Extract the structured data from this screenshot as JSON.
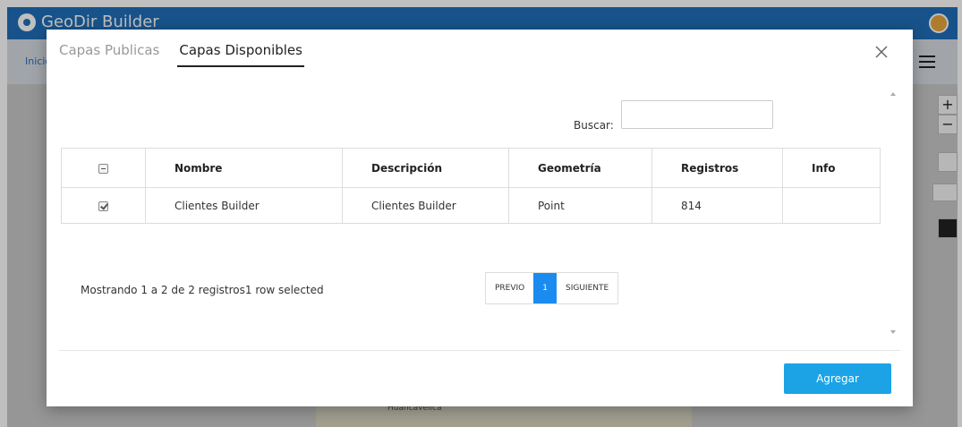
{
  "app": {
    "title": "GeoDir Builder",
    "breadcrumb": "Inicio",
    "map_label": "Huancavelica"
  },
  "map_controls": {
    "zoom_in": "+",
    "zoom_out": "−"
  },
  "modal": {
    "tabs": [
      {
        "label": "Capas Publicas",
        "active": false
      },
      {
        "label": "Capas Disponibles",
        "active": true
      }
    ],
    "close_icon": "close-icon",
    "search": {
      "label": "Buscar:",
      "value": ""
    },
    "table": {
      "columns": [
        "",
        "Nombre",
        "Descripción",
        "Geometría",
        "Registros",
        "Info"
      ],
      "rows": [
        {
          "selected": true,
          "nombre": "Clientes Builder",
          "descripcion": "Clientes Builder",
          "geometria": "Point",
          "registros": "814",
          "info": ""
        }
      ]
    },
    "info_text": "Mostrando 1 a 2 de 2 registros1 row selected",
    "pagination": {
      "prev": "PREVIO",
      "current": "1",
      "next": "SIGUIENTE"
    },
    "add_button": "Agregar"
  },
  "colors": {
    "header": "#1f6fb8",
    "accent": "#1ba3e6",
    "page_current": "#1a8cef"
  }
}
